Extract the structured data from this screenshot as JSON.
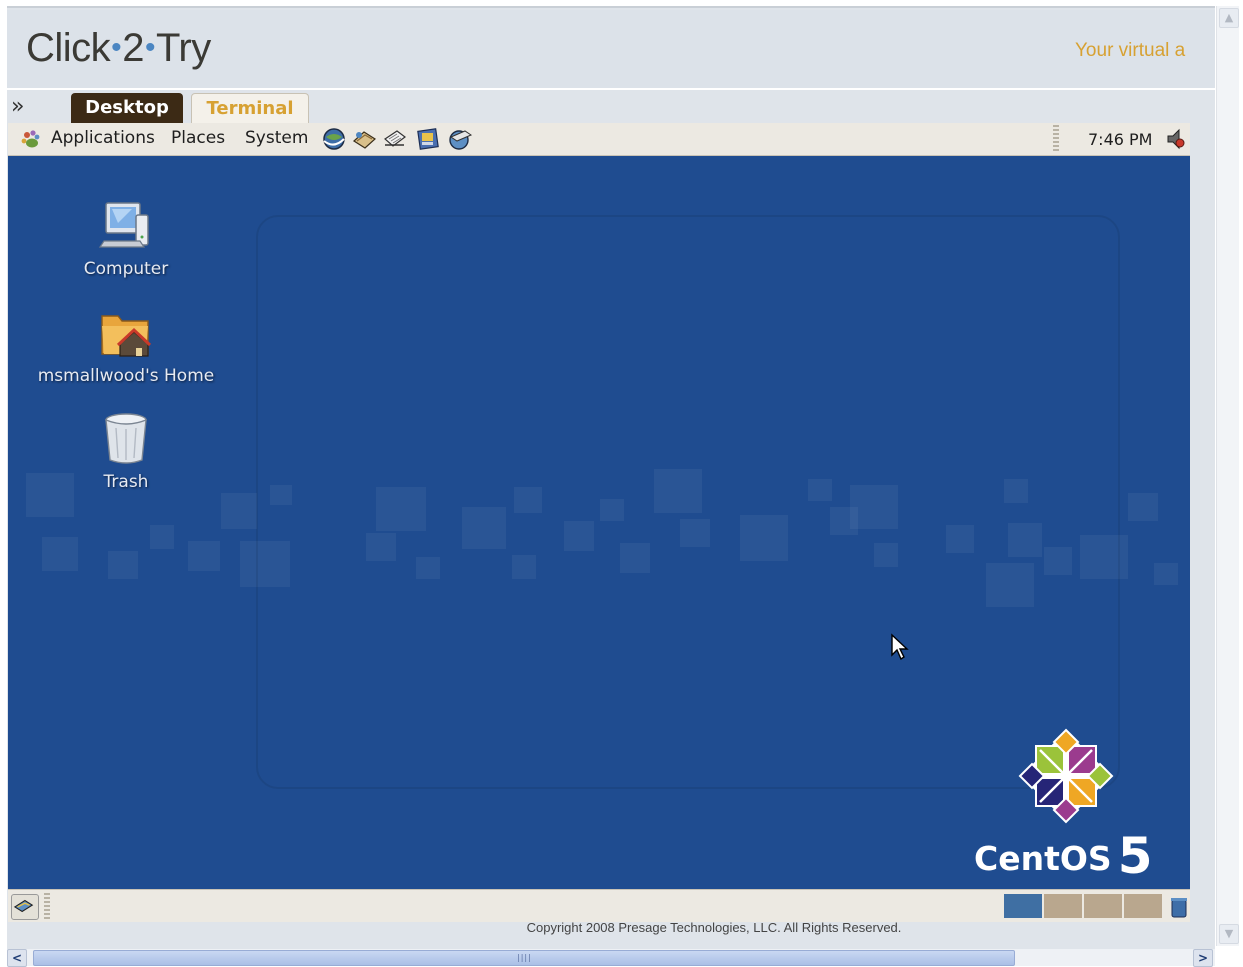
{
  "header": {
    "logo_text_1": "Click",
    "logo_sep": "•",
    "logo_text_2": "2",
    "logo_text_3": "Try",
    "tagline": "Your virtual a"
  },
  "tabs": {
    "toggle_glyph": "»",
    "items": [
      {
        "label": "Desktop",
        "active": true
      },
      {
        "label": "Terminal",
        "active": false
      }
    ]
  },
  "gnome_panel": {
    "menus": [
      "Applications",
      "Places",
      "System"
    ],
    "launchers": [
      "web-browser-icon",
      "email-icon",
      "text-editor-icon",
      "document-icon",
      "network-icon"
    ],
    "clock": "7:46 PM",
    "volume_icon": "volume-icon"
  },
  "desktop_icons": [
    {
      "label": "Computer",
      "icon": "computer-icon"
    },
    {
      "label": "msmallwood's Home",
      "icon": "home-folder-icon"
    },
    {
      "label": "Trash",
      "icon": "trash-icon"
    }
  ],
  "branding": {
    "os_name": "CentOS",
    "os_version": "5"
  },
  "bottom_panel": {
    "workspaces": 4,
    "active_workspace": 1
  },
  "footer": {
    "copyright": "Copyright 2008 Presage Technologies, LLC. All Rights Reserved."
  },
  "colors": {
    "desktop_bg": "#1f4c90",
    "panel_bg": "#ece9e2",
    "tab_active": "#3c2a15",
    "tab_text_inactive": "#d7a132",
    "accent_gold": "#d7a132"
  }
}
